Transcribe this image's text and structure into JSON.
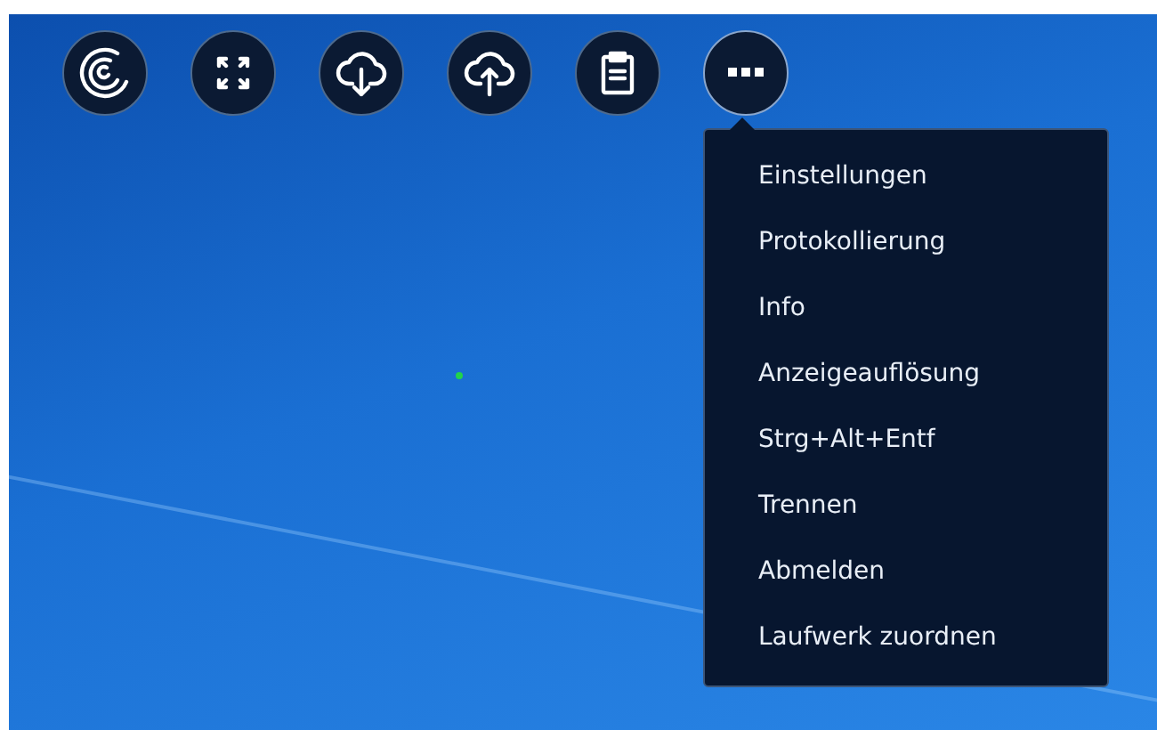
{
  "menu": {
    "open": true,
    "items": [
      "Einstellungen",
      "Protokollierung",
      "Info",
      "Anzeigeauflösung",
      "Strg+Alt+Entf",
      "Trennen",
      "Abmelden",
      "Laufwerk zuordnen"
    ]
  }
}
